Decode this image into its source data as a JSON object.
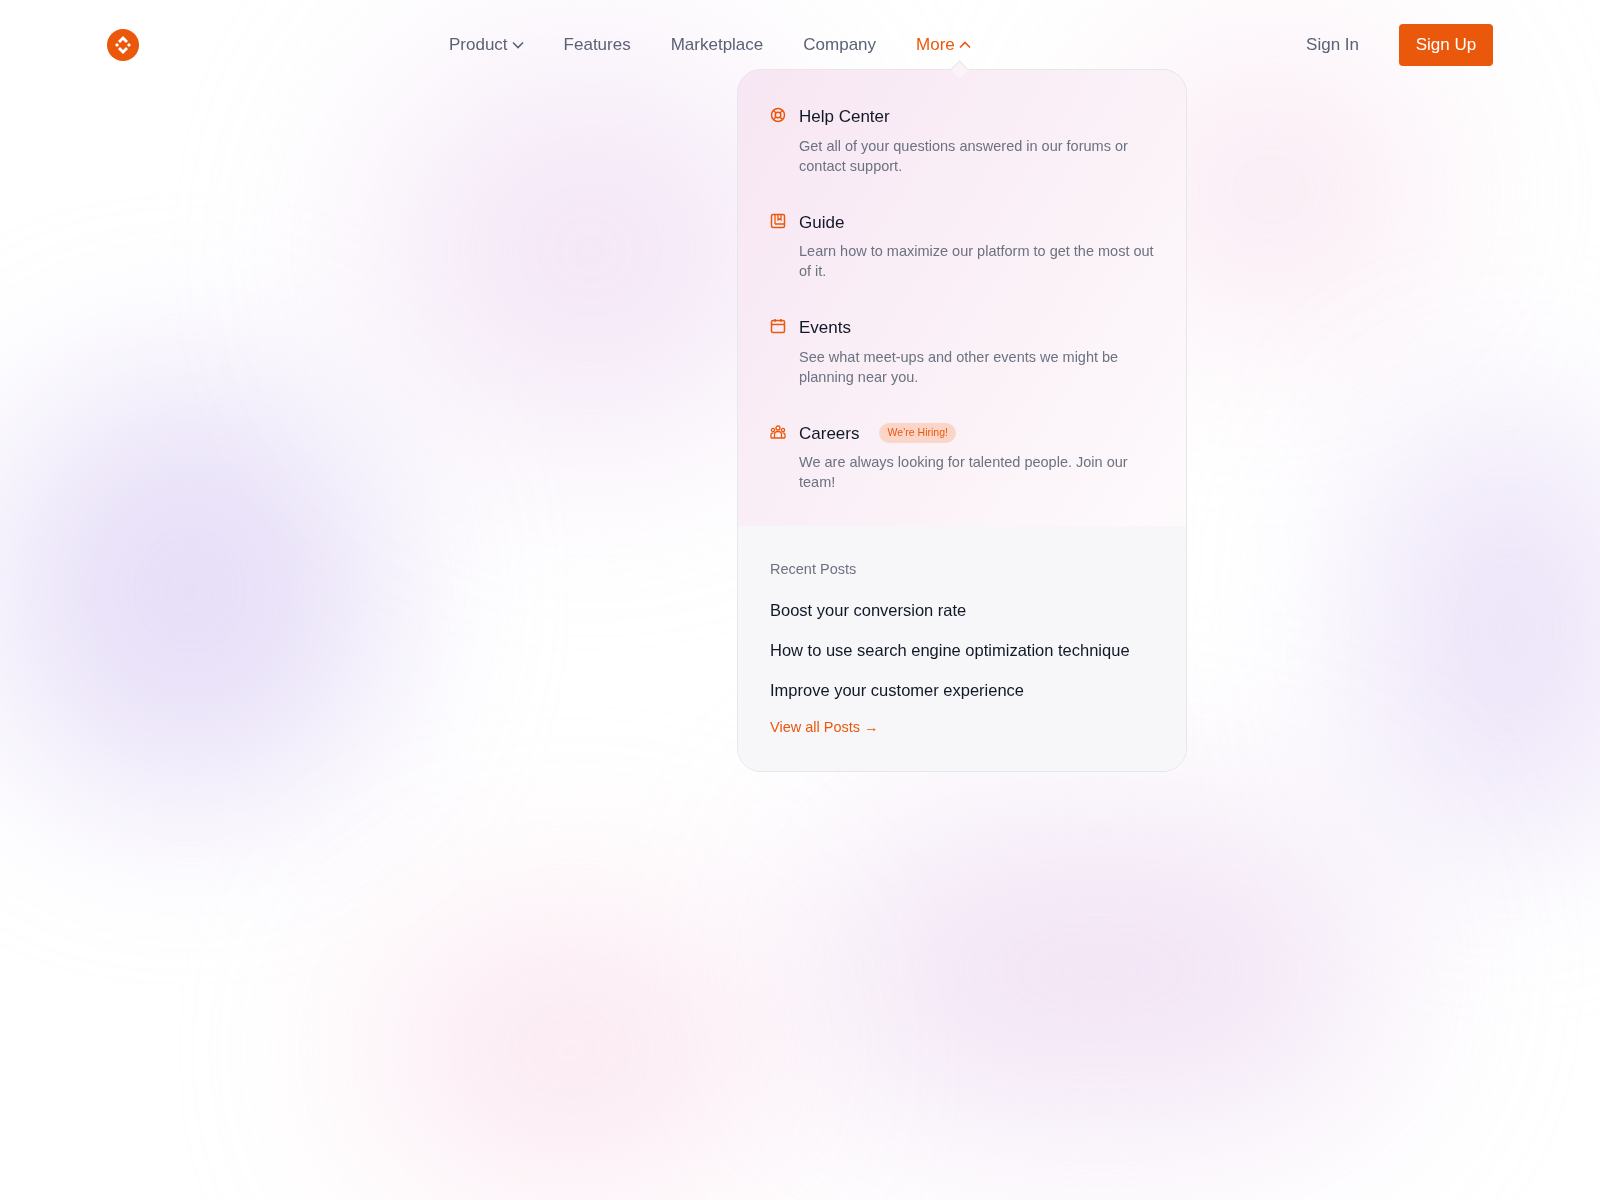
{
  "nav": {
    "items": [
      {
        "label": "Product",
        "kind": "dropdown",
        "selected": false
      },
      {
        "label": "Features",
        "kind": "link",
        "selected": false
      },
      {
        "label": "Marketplace",
        "kind": "link",
        "selected": false
      },
      {
        "label": "Company",
        "kind": "link",
        "selected": false
      },
      {
        "label": "More",
        "kind": "dropdown",
        "selected": true
      }
    ],
    "sign_in": "Sign In",
    "sign_up": "Sign Up"
  },
  "dropdown": {
    "items": [
      {
        "kind": "help",
        "title": "Help Center",
        "description": "Get all of your questions answered in our forums or contact support."
      },
      {
        "kind": "guide",
        "title": "Guide",
        "description": "Learn how to maximize our platform to get the most out of it."
      },
      {
        "kind": "events",
        "title": "Events",
        "description": "See what meet-ups and other events we might be planning near you."
      },
      {
        "kind": "careers",
        "title": "Careers",
        "badge": "We’re Hiring!",
        "description": "We are always looking for talented people. Join our team!"
      }
    ],
    "recent_posts": {
      "heading": "Recent Posts",
      "posts": [
        "Boost your conversion rate",
        "How to use search engine optimization technique",
        "Improve your customer experience"
      ],
      "view_all": "View all Posts →"
    }
  }
}
